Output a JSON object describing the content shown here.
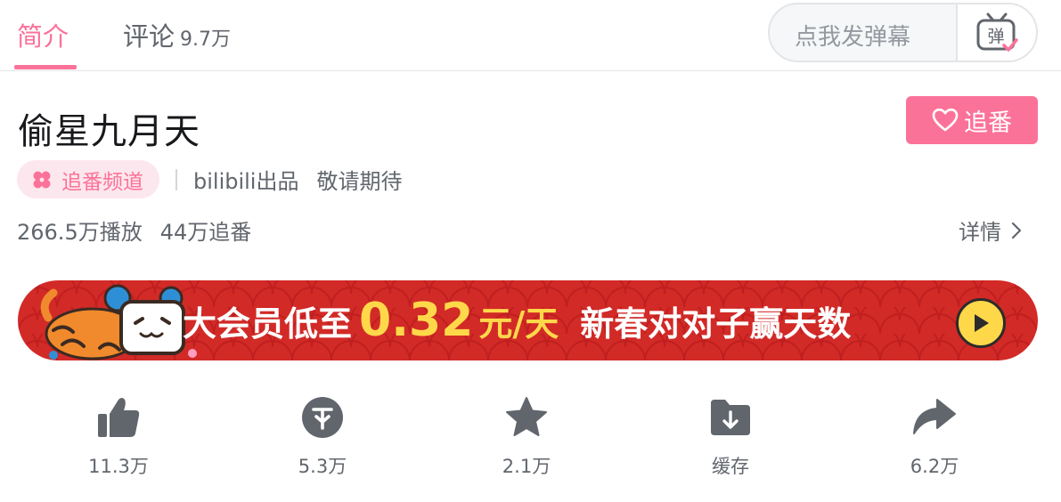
{
  "tabs": {
    "intro": {
      "label": "简介"
    },
    "comments": {
      "label": "评论",
      "count": "9.7万"
    }
  },
  "danmaku": {
    "placeholder": "点我发弹幕",
    "button_glyph": "弹"
  },
  "show": {
    "title": "偷星九月天",
    "follow_label": "追番",
    "channel_tag": "追番频道",
    "producer": "bilibili出品",
    "status": "敬请期待",
    "plays": "266.5万播放",
    "follows": "44万追番",
    "details_label": "详情"
  },
  "banner": {
    "text_before": "大会员低至",
    "price": "0.32",
    "unit": "元/天",
    "text_after": "新春对对子赢天数"
  },
  "actions": [
    {
      "icon": "thumbs-up-icon",
      "label": "11.3万"
    },
    {
      "icon": "coin-icon",
      "label": "5.3万"
    },
    {
      "icon": "star-icon",
      "label": "2.1万"
    },
    {
      "icon": "cache-icon",
      "label": "缓存"
    },
    {
      "icon": "share-icon",
      "label": "6.2万"
    }
  ],
  "colors": {
    "accent": "#fb7299",
    "text_secondary": "#61666d",
    "banner_red": "#d22a27",
    "banner_gold": "#ffd84a",
    "icon_gray": "#61666d"
  }
}
